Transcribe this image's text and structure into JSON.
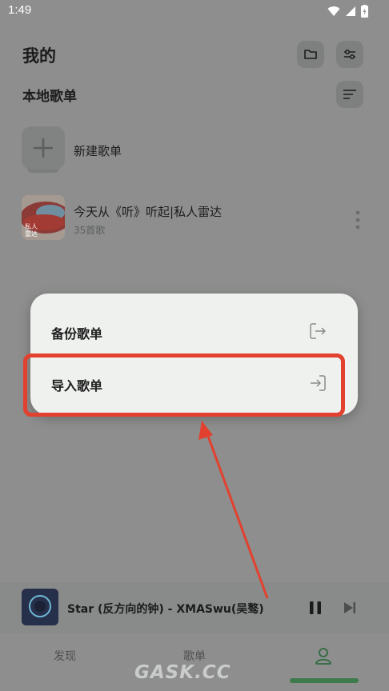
{
  "status_bar": {
    "time": "1:49"
  },
  "header": {
    "title": "我的"
  },
  "section": {
    "title": "本地歌单"
  },
  "new_playlist": {
    "label": "新建歌单"
  },
  "playlist": {
    "name": "今天从《听》听起|私人雷达",
    "count": "35首歌",
    "cover_text": "私人\n雷达"
  },
  "menu": {
    "items": [
      {
        "label": "备份歌单"
      },
      {
        "label": "导入歌单"
      }
    ]
  },
  "player": {
    "title": "Star (反方向的钟) - XMASwu(吴骜)"
  },
  "tabs": [
    {
      "label": "发现"
    },
    {
      "label": "歌单"
    }
  ],
  "watermark": "GASK.CC",
  "colors": {
    "highlight": "#e2412f",
    "accent": "#3d7b4d",
    "menu_bg": "#eef1ee"
  }
}
